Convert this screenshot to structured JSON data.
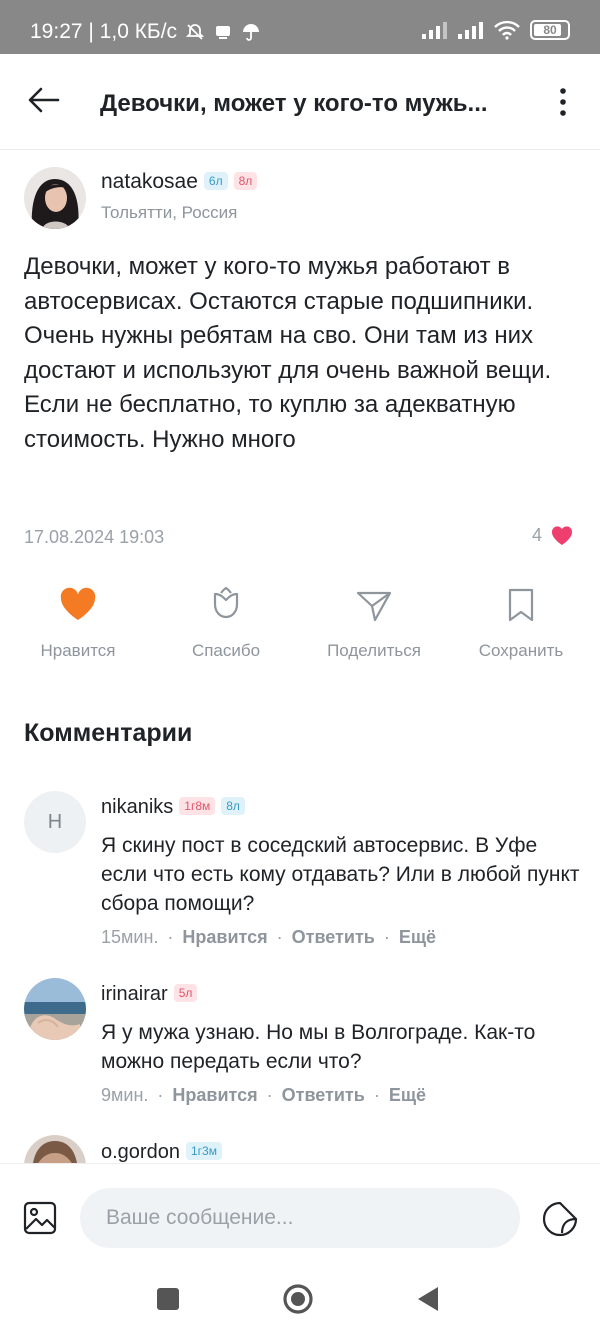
{
  "status_bar": {
    "time_info": "19:27 | 1,0 КБ/с",
    "battery": "80"
  },
  "header": {
    "title": "Девочки, может у кого-то мужь..."
  },
  "post": {
    "author": {
      "name": "natakosae",
      "badges": [
        "6л",
        "8л"
      ],
      "location": "Тольятти, Россия"
    },
    "text": "Девочки, может у кого-то мужья работают в автосервисах. Остаются старые подшипники. Очень нужны ребятам на сво. Они там из них достают и используют для очень важной вещи.\nЕсли не бесплатно, то куплю за адекватную стоимость. Нужно много",
    "date": "17.08.2024 19:03",
    "likes": "4"
  },
  "actions": [
    {
      "label": "Нравится",
      "icon": "heart-icon"
    },
    {
      "label": "Спасибо",
      "icon": "tulip-icon"
    },
    {
      "label": "Поделиться",
      "icon": "send-icon"
    },
    {
      "label": "Сохранить",
      "icon": "bookmark-icon"
    }
  ],
  "comments_title": "Комментарии",
  "comments": [
    {
      "avatar_letter": "Н",
      "name": "nikaniks",
      "badges": [
        "1г8м",
        "8л"
      ],
      "text": "Я скину пост  в соседский автосервис. В Уфе если что есть кому отдавать? Или в любой пункт сбора помощи?",
      "time": "15мин.",
      "like": "Нравится",
      "reply": "Ответить",
      "more": "Ещё"
    },
    {
      "name": "irinairar",
      "badges": [
        "5л"
      ],
      "text": "Я у мужа узнаю. Но мы в Волгограде. Как-то можно передать если что?",
      "time": "9мин.",
      "like": "Нравится",
      "reply": "Ответить",
      "more": "Ещё"
    },
    {
      "name": "o.gordon",
      "badges": [
        "1г3м"
      ]
    }
  ],
  "composer": {
    "placeholder": "Ваше сообщение..."
  },
  "colors": {
    "accent_orange": "#f57a24",
    "heart_pink": "#ef3f6f",
    "muted": "#9aa1a8"
  }
}
